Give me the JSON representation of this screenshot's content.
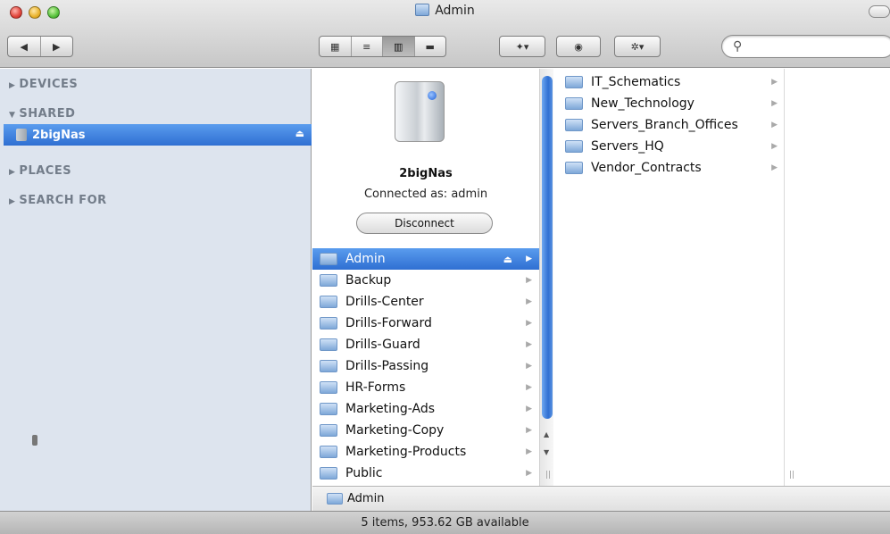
{
  "window": {
    "title": "Admin"
  },
  "toolbar": {
    "nav_back": "◀",
    "nav_forward": "▶",
    "view_modes": [
      "▦",
      "≡",
      "▥",
      "▬"
    ],
    "active_view": 2,
    "dropbox_label": "✦▾",
    "quicklook_label": "◉",
    "action_label": "✲▾",
    "search_placeholder": "",
    "search_icon": "🔍"
  },
  "sidebar": {
    "sections": [
      {
        "label": "DEVICES",
        "expanded": false
      },
      {
        "label": "SHARED",
        "expanded": true
      },
      {
        "label": "PLACES",
        "expanded": false
      },
      {
        "label": "SEARCH FOR",
        "expanded": false
      }
    ],
    "selected_item": "2bigNas"
  },
  "device": {
    "name": "2bigNas",
    "connection": "Connected as: admin",
    "disconnect_label": "Disconnect"
  },
  "column1": {
    "items": [
      "Admin",
      "Backup",
      "Drills-Center",
      "Drills-Forward",
      "Drills-Guard",
      "Drills-Passing",
      "HR-Forms",
      "Marketing-Ads",
      "Marketing-Copy",
      "Marketing-Products",
      "Public"
    ],
    "selected": 0
  },
  "column2": {
    "items": [
      "IT_Schematics",
      "New_Technology",
      "Servers_Branch_Offices",
      "Servers_HQ",
      "Vendor_Contracts"
    ]
  },
  "pathbar": {
    "folder": "Admin"
  },
  "status": {
    "text": "5 items, 953.62 GB available"
  },
  "colors": {
    "selection": "#2f6fd2",
    "sidebar_bg": "#dde4ee",
    "sidebar_heading": "#737d8a"
  }
}
